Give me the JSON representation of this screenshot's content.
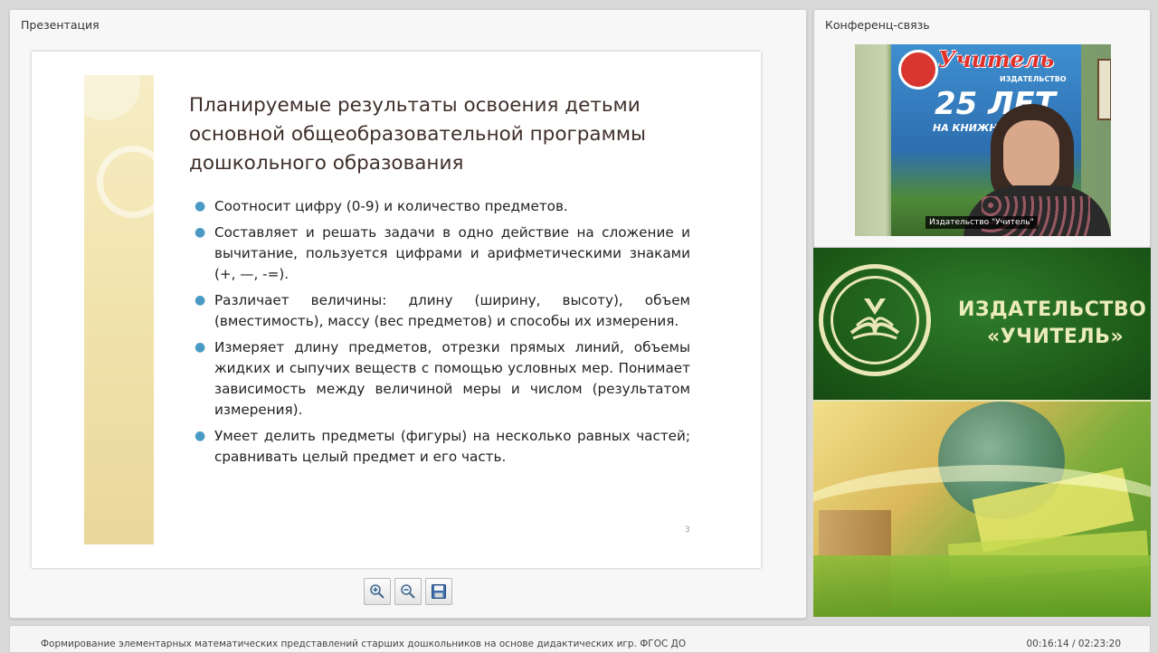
{
  "presentation": {
    "panel_title": "Презентация",
    "slide": {
      "title_lines": [
        "Планируемые результаты освоения детьми",
        "основной общеобразовательной программы",
        "дошкольного образования"
      ],
      "bullets": [
        "Соотносит цифру (0-9) и количество предметов.",
        "Составляет и решать задачи в одно действие на сложение и вычитание, пользуется цифрами и арифметическими знаками (+, —, -=).",
        "Различает величины: длину (ширину, высоту), объем (вместимость), массу (вес предметов) и способы их измерения.",
        "Измеряет длину предметов, отрезки прямых линий, объемы жидких и сыпучих веществ с помощью условных мер. Понимает зависимость между величиной меры и числом (результатом измерения).",
        "Умеет делить предметы (фигуры) на несколько равных частей; сравнивать целый предмет и его часть."
      ],
      "page_number": "3"
    },
    "toolbar": {
      "zoom_in_icon": "zoom-in-icon",
      "zoom_out_icon": "zoom-out-icon",
      "save_icon": "save-icon"
    }
  },
  "conference": {
    "panel_title": "Конференц-связь",
    "poster": {
      "title": "Учитель",
      "subtitle": "ИЗДАТЕЛЬСТВО",
      "years": "25 ЛЕТ",
      "line2": "НА КНИЖНОМ Р"
    },
    "speaker_caption": "Издательство \"Учитель\""
  },
  "banner": {
    "line1": "ИЗДАТЕЛЬСТВО",
    "line2": "«УЧИТЕЛЬ»"
  },
  "footer": {
    "course_title": "Формирование элементарных математических представлений старших дошкольников на основе дидактических игр. ФГОС ДО",
    "time": "00:16:14 / 02:23:20"
  },
  "colors": {
    "bullet": "#4a9ac4",
    "title_text": "#3f2f2a",
    "banner_green": "#1c5a18",
    "banner_text": "#ecebbb"
  }
}
